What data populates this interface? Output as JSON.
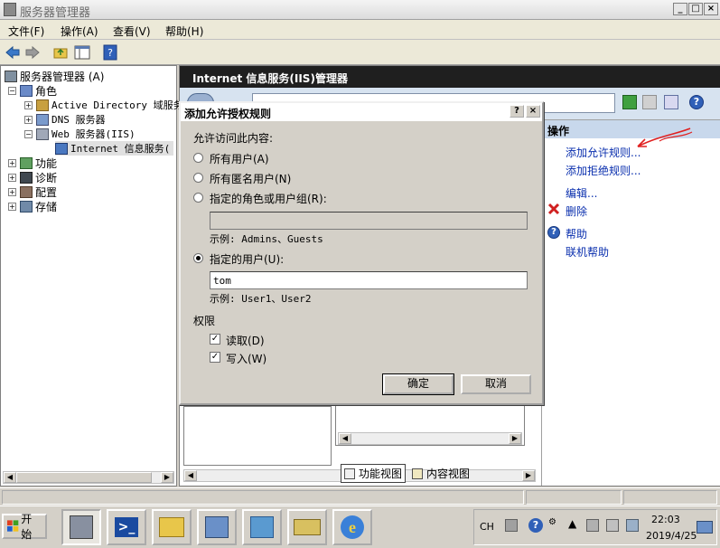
{
  "window": {
    "title": "服务器管理器",
    "buttons": [
      "_",
      "□",
      "×"
    ]
  },
  "menubar": {
    "items": [
      "文件(F)",
      "操作(A)",
      "查看(V)",
      "帮助(H)"
    ]
  },
  "tree": {
    "items": [
      {
        "label": "服务器管理器 (A)",
        "icon": "server-manager-icon"
      },
      {
        "label": "角色",
        "icon": "roles-icon"
      },
      {
        "label": "Active Directory 域服务",
        "icon": "ad-icon"
      },
      {
        "label": "DNS 服务器",
        "icon": "dns-icon"
      },
      {
        "label": "Web 服务器(IIS)",
        "icon": "web-server-icon"
      },
      {
        "label": "Internet 信息服务(",
        "icon": "iis-icon"
      },
      {
        "label": "功能",
        "icon": "features-icon"
      },
      {
        "label": "诊断",
        "icon": "diagnostics-icon"
      },
      {
        "label": "配置",
        "icon": "configuration-icon"
      },
      {
        "label": "存储",
        "icon": "storage-icon"
      }
    ]
  },
  "main": {
    "header": "Internet 信息服务(IIS)管理器",
    "actions": {
      "title": "操作",
      "items": [
        {
          "label": "添加允许规则...",
          "icon": ""
        },
        {
          "label": "添加拒绝规则...",
          "icon": ""
        },
        {
          "label": "编辑...",
          "icon": ""
        },
        {
          "label": "删除",
          "icon": "delete-icon"
        },
        {
          "label": "帮助",
          "icon": "help-icon"
        },
        {
          "label": "联机帮助",
          "icon": ""
        }
      ]
    },
    "view_tabs": [
      "功能视图",
      "内容视图"
    ]
  },
  "dialog": {
    "title": "添加允许授权规则",
    "prompt": "允许访问此内容:",
    "options": {
      "all_users": "所有用户(A)",
      "anonymous": "所有匿名用户(N)",
      "roles": "指定的角色或用户组(R):",
      "roles_value": "",
      "roles_example": "示例: Admins、Guests",
      "users": "指定的用户(U):",
      "users_value": "tom",
      "users_example": "示例: User1、User2"
    },
    "selected_option": "users",
    "permissions_label": "权限",
    "read_label": "读取(D)",
    "write_label": "写入(W)",
    "read_checked": true,
    "write_checked": true,
    "ok_label": "确定",
    "cancel_label": "取消",
    "help_btn": "?",
    "close_btn": "×"
  },
  "taskbar": {
    "start_label": "开始",
    "tray": {
      "lang": "CH",
      "time": "22:03",
      "date": "2019/4/25"
    }
  },
  "colors": {
    "link": "#0a2fae",
    "header_dark": "#1f1f1f",
    "annotation_red": "#e02020"
  }
}
